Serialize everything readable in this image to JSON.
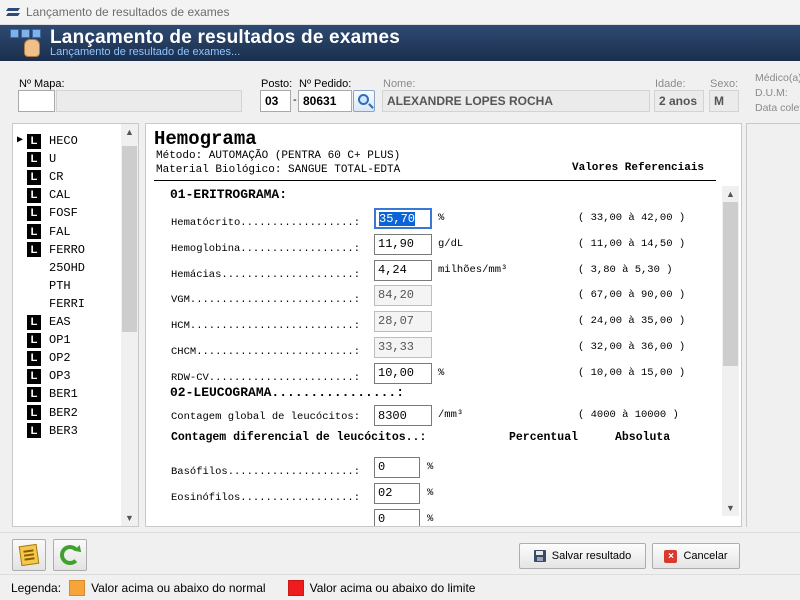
{
  "window": {
    "title": "Lançamento de resultados de exames"
  },
  "banner": {
    "title": "Lançamento de resultados de exames",
    "subtitle": "Lançamento de resultado de exames..."
  },
  "header": {
    "mapa_label": "Nº Mapa:",
    "mapa_value": "",
    "mapa_desc": "",
    "posto_label": "Posto:",
    "posto_value": "03",
    "dash": "-",
    "pedido_label": "Nº Pedido:",
    "pedido_value": "80631",
    "nome_label": "Nome:",
    "nome_value": "ALEXANDRE LOPES ROCHA",
    "idade_label": "Idade:",
    "idade_value": "2 anos",
    "sexo_label": "Sexo:",
    "sexo_value": "M",
    "medico_label": "Médico(a)",
    "dum_label": "D.U.M:",
    "data_coleta_label": "Data colet"
  },
  "exam_list": [
    {
      "code": "HECO",
      "badge": "L",
      "current": true
    },
    {
      "code": "U",
      "badge": "L",
      "current": false
    },
    {
      "code": "CR",
      "badge": "L",
      "current": false
    },
    {
      "code": "CAL",
      "badge": "L",
      "current": false
    },
    {
      "code": "FOSF",
      "badge": "L",
      "current": false
    },
    {
      "code": "FAL",
      "badge": "L",
      "current": false
    },
    {
      "code": "FERRO",
      "badge": "L",
      "current": false
    },
    {
      "code": "25OHD",
      "badge": "",
      "current": false
    },
    {
      "code": "PTH",
      "badge": "",
      "current": false
    },
    {
      "code": "FERRI",
      "badge": "",
      "current": false
    },
    {
      "code": "EAS",
      "badge": "L",
      "current": false
    },
    {
      "code": "OP1",
      "badge": "L",
      "current": false
    },
    {
      "code": "OP2",
      "badge": "L",
      "current": false
    },
    {
      "code": "OP3",
      "badge": "L",
      "current": false
    },
    {
      "code": "BER1",
      "badge": "L",
      "current": false
    },
    {
      "code": "BER2",
      "badge": "L",
      "current": false
    },
    {
      "code": "BER3",
      "badge": "L",
      "current": false
    }
  ],
  "result": {
    "title": "Hemograma",
    "metodo": "Método: AUTOMAÇÃO (PENTRA 60 C+ PLUS)",
    "material": "Material Biológico: SANGUE TOTAL-EDTA",
    "ref_header": "Valores Referenciais",
    "section1": "01-ERITROGRAMA:",
    "eritro": [
      {
        "label": "Hematócrito..................:",
        "value": "35,70",
        "unit": "%",
        "ref": "( 33,00 à 42,00 )",
        "editable": true,
        "selected": true
      },
      {
        "label": "Hemoglobina..................:",
        "value": "11,90",
        "unit": "g/dL",
        "ref": "( 11,00 à 14,50 )",
        "editable": true,
        "selected": false
      },
      {
        "label": "Hemácias.....................:",
        "value": "4,24",
        "unit": "milhões/mm³",
        "ref": "( 3,80 à 5,30 )",
        "editable": true,
        "selected": false
      },
      {
        "label": "VGM..........................:",
        "value": "84,20",
        "unit": "",
        "ref": "( 67,00 à 90,00 )",
        "editable": false,
        "selected": false
      },
      {
        "label": "HCM..........................:",
        "value": "28,07",
        "unit": "",
        "ref": "( 24,00 à 35,00 )",
        "editable": false,
        "selected": false
      },
      {
        "label": "CHCM.........................:",
        "value": "33,33",
        "unit": "",
        "ref": "( 32,00 à 36,00 )",
        "editable": false,
        "selected": false
      },
      {
        "label": "RDW-CV.......................:",
        "value": "10,00",
        "unit": "%",
        "ref": "( 10,00 à 15,00 )",
        "editable": true,
        "selected": false
      }
    ],
    "section2": "02-LEUCOGRAMA................:",
    "leuco_global": {
      "label": "Contagem global de leucócitos:",
      "value": "8300",
      "unit": "/mm³",
      "ref": "( 4000 à 10000 )"
    },
    "diff_header": "Contagem diferencial de leucócitos..:",
    "col_percentual": "Percentual",
    "col_absoluta": "Absoluta",
    "diff": [
      {
        "label": "Basófilos....................:",
        "value": "0",
        "unit": "%"
      },
      {
        "label": "Eosinófilos..................:",
        "value": "02",
        "unit": "%"
      },
      {
        "label": "",
        "value": "0",
        "unit": "%"
      }
    ]
  },
  "buttons": {
    "save": "Salvar resultado",
    "cancel": "Cancelar"
  },
  "legend": {
    "label": "Legenda:",
    "items": [
      {
        "color": "#f7a43a",
        "text": "Valor acima ou abaixo do normal"
      },
      {
        "color": "#ee1c1c",
        "text": "Valor acima ou abaixo do limite"
      }
    ]
  }
}
